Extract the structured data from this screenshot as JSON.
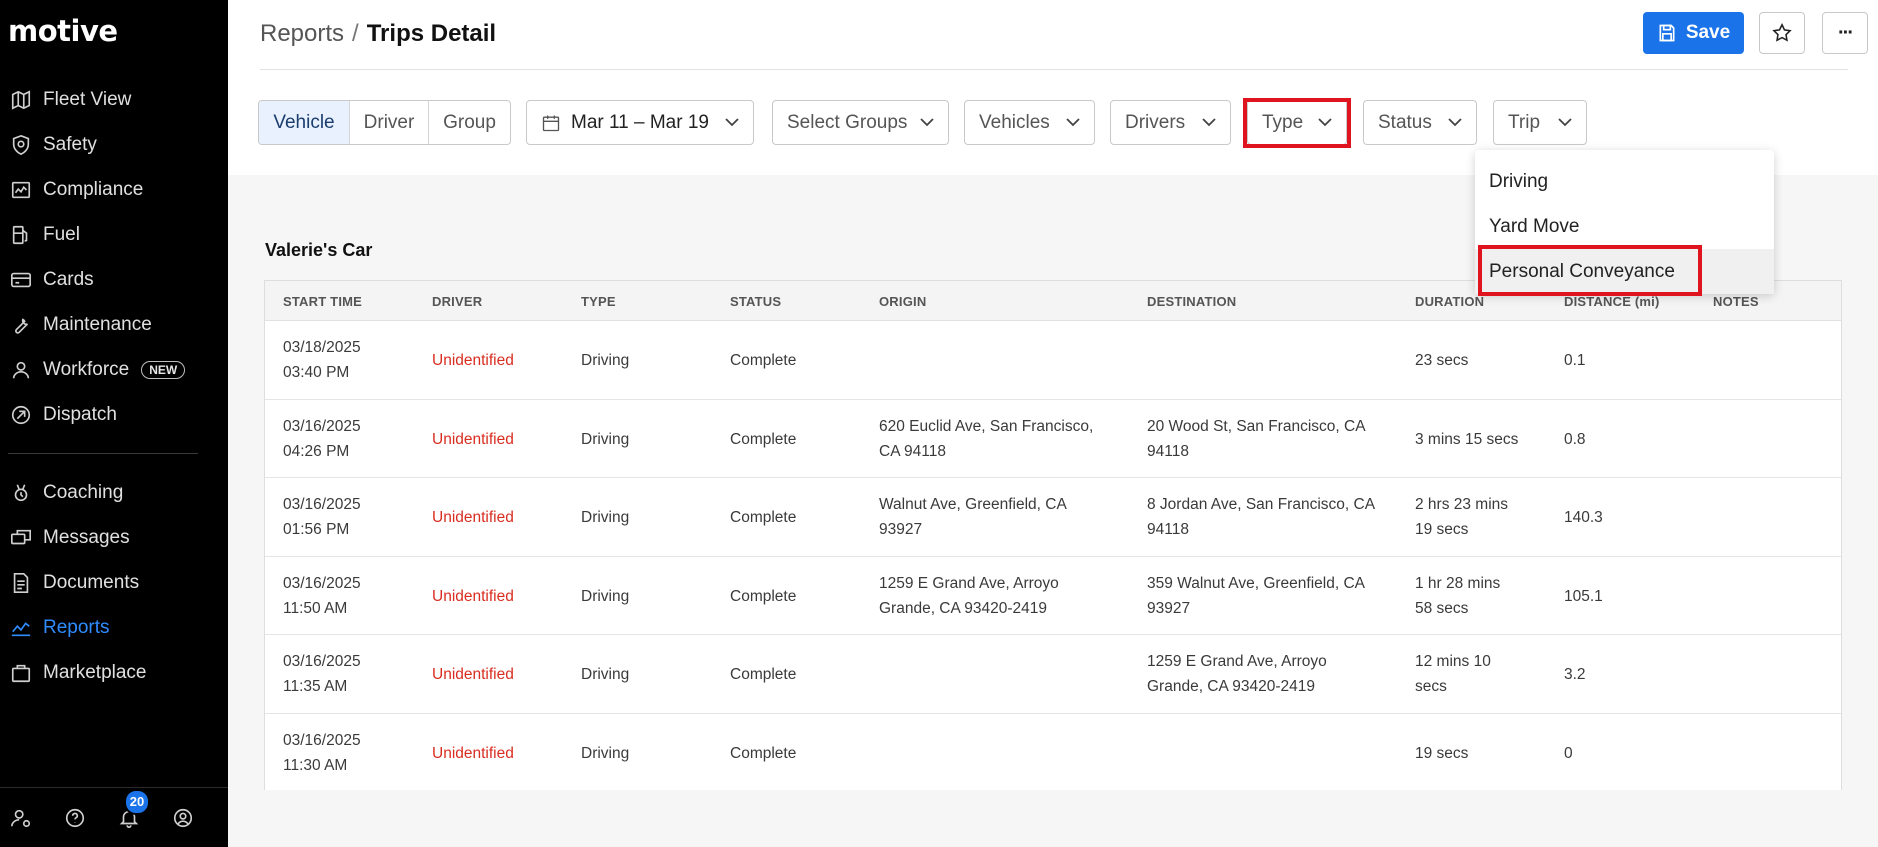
{
  "app": {
    "logo": "motive"
  },
  "sidebar": {
    "items": [
      {
        "label": "Fleet View",
        "icon": "map-icon"
      },
      {
        "label": "Safety",
        "icon": "shield-icon"
      },
      {
        "label": "Compliance",
        "icon": "compliance-icon"
      },
      {
        "label": "Fuel",
        "icon": "fuel-icon"
      },
      {
        "label": "Cards",
        "icon": "card-icon"
      },
      {
        "label": "Maintenance",
        "icon": "wrench-icon"
      },
      {
        "label": "Workforce",
        "icon": "person-icon",
        "badge": "NEW"
      },
      {
        "label": "Dispatch",
        "icon": "dispatch-icon"
      },
      {
        "label": "Coaching",
        "icon": "coaching-icon"
      },
      {
        "label": "Messages",
        "icon": "messages-icon"
      },
      {
        "label": "Documents",
        "icon": "document-icon"
      },
      {
        "label": "Reports",
        "icon": "chart-icon",
        "active": true
      },
      {
        "label": "Marketplace",
        "icon": "bag-icon"
      }
    ],
    "notification_count": "20"
  },
  "header": {
    "breadcrumb_parent": "Reports",
    "breadcrumb_sep": "/",
    "breadcrumb_current": "Trips Detail",
    "save_label": "Save",
    "more_label": "···"
  },
  "filters": {
    "segments": [
      "Vehicle",
      "Driver",
      "Group"
    ],
    "date_range": "Mar 11 – Mar 19",
    "groups": "Select Groups",
    "vehicles": "Vehicles",
    "drivers": "Drivers",
    "type": "Type",
    "status": "Status",
    "trip": "Trip"
  },
  "type_dropdown": {
    "options": [
      "Driving",
      "Yard Move",
      "Personal Conveyance"
    ]
  },
  "table": {
    "title": "Valerie's Car",
    "columns": [
      "START TIME",
      "DRIVER",
      "TYPE",
      "STATUS",
      "ORIGIN",
      "DESTINATION",
      "DURATION",
      "DISTANCE (mi)",
      "NOTES"
    ],
    "rows": [
      {
        "date": "03/18/2025",
        "time": "03:40 PM",
        "driver": "Unidentified",
        "type": "Driving",
        "status": "Complete",
        "origin1": "",
        "origin2": "",
        "dest1": "",
        "dest2": "",
        "dur1": "23 secs",
        "dur2": "",
        "distance": "0.1"
      },
      {
        "date": "03/16/2025",
        "time": "04:26 PM",
        "driver": "Unidentified",
        "type": "Driving",
        "status": "Complete",
        "origin1": "620 Euclid Ave, San Francisco,",
        "origin2": "CA 94118",
        "dest1": "20 Wood St, San Francisco, CA",
        "dest2": "94118",
        "dur1": "3 mins 15 secs",
        "dur2": "",
        "distance": "0.8"
      },
      {
        "date": "03/16/2025",
        "time": "01:56 PM",
        "driver": "Unidentified",
        "type": "Driving",
        "status": "Complete",
        "origin1": "Walnut Ave, Greenfield, CA",
        "origin2": "93927",
        "dest1": "8 Jordan Ave, San Francisco, CA",
        "dest2": "94118",
        "dur1": "2 hrs 23 mins",
        "dur2": "19 secs",
        "distance": "140.3"
      },
      {
        "date": "03/16/2025",
        "time": "11:50 AM",
        "driver": "Unidentified",
        "type": "Driving",
        "status": "Complete",
        "origin1": "1259 E Grand Ave, Arroyo",
        "origin2": "Grande, CA 93420-2419",
        "dest1": "359 Walnut Ave, Greenfield, CA",
        "dest2": "93927",
        "dur1": "1 hr 28 mins",
        "dur2": "58 secs",
        "distance": "105.1"
      },
      {
        "date": "03/16/2025",
        "time": "11:35 AM",
        "driver": "Unidentified",
        "type": "Driving",
        "status": "Complete",
        "origin1": "",
        "origin2": "",
        "dest1": "1259 E Grand Ave, Arroyo",
        "dest2": "Grande, CA 93420-2419",
        "dur1": "12 mins 10",
        "dur2": "secs",
        "distance": "3.2"
      },
      {
        "date": "03/16/2025",
        "time": "11:30 AM",
        "driver": "Unidentified",
        "type": "Driving",
        "status": "Complete",
        "origin1": "",
        "origin2": "",
        "dest1": "",
        "dest2": "",
        "dur1": "19 secs",
        "dur2": "",
        "distance": "0"
      }
    ]
  },
  "colors": {
    "accent": "#1a73e8",
    "highlight": "#e0141e",
    "driver_unidentified": "#d92d20",
    "sidebar_bg": "#000000"
  }
}
